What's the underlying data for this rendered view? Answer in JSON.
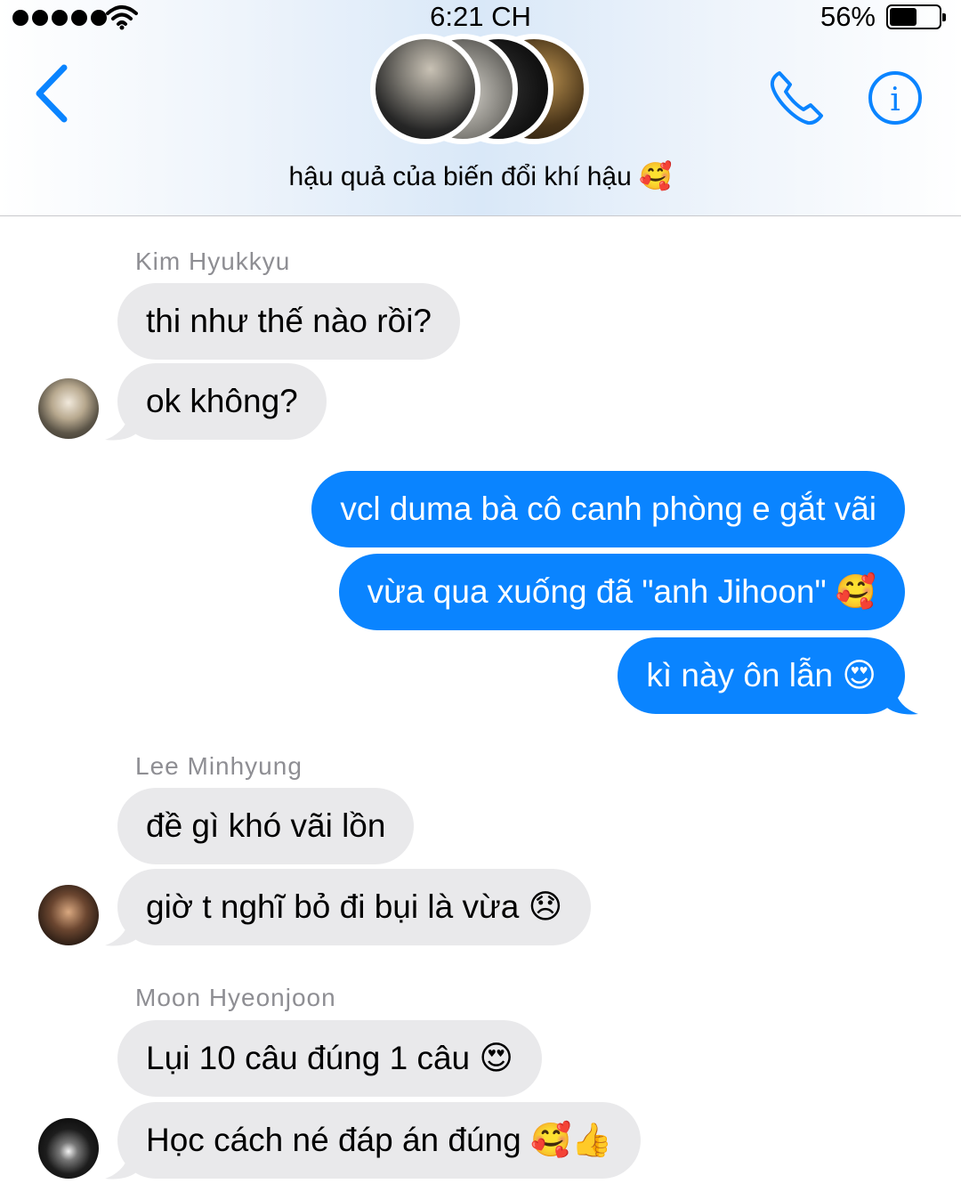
{
  "status_bar": {
    "time": "6:21 CH",
    "battery_percent": "56%",
    "battery_level": 0.56,
    "signal_bars": 5,
    "wifi_icon": "wifi-icon"
  },
  "header": {
    "title": "hậu quả của biến đổi khí hậu 🥰",
    "back_icon": "chevron-left-icon",
    "call_icon": "phone-icon",
    "info_icon": "info-icon",
    "accent_color": "#0a84ff",
    "group_avatar_count": 4
  },
  "messages": [
    {
      "sender": "Kim Hyukkyu",
      "direction": "incoming",
      "bubbles": [
        "thi như thế nào rồi?",
        "ok không?"
      ]
    },
    {
      "sender": "",
      "direction": "outgoing",
      "bubbles": [
        "vcl duma bà cô canh phòng e gắt vãi",
        "vừa qua xuống đã \"anh Jihoon\" 🥰",
        "kì này ôn lẫn 😍"
      ]
    },
    {
      "sender": "Lee Minhyung",
      "direction": "incoming",
      "bubbles": [
        "đề gì khó vãi lồn",
        "giờ t nghĩ bỏ đi bụi là vừa 😞"
      ]
    },
    {
      "sender": "Moon Hyeonjoon",
      "direction": "incoming",
      "bubbles": [
        "Lụi 10 câu đúng 1 câu 😍",
        "Học cách né đáp án đúng 🥰👍"
      ]
    }
  ],
  "colors": {
    "incoming_bubble": "#e9e9eb",
    "outgoing_bubble": "#0a84ff",
    "sender_name": "#8e8e93"
  }
}
